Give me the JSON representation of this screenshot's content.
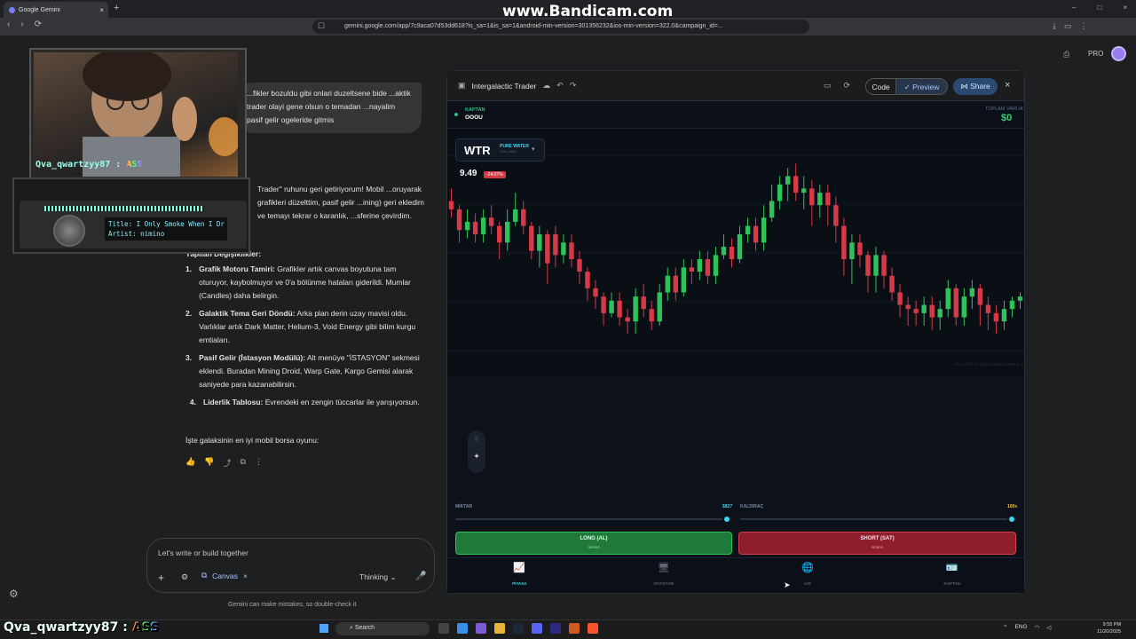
{
  "browser": {
    "tab_title": "Google Gemini",
    "tab_close": "×",
    "new_tab": "+",
    "window_controls": [
      "–",
      "□",
      "×"
    ],
    "url": "gemini.google.com/app/7c9aca07d53dd618?is_sa=1&is_sa=1&android-min-version=301356232&ios-min-version=322.0&campaign_id=...",
    "nav": [
      "‹",
      "›",
      "⟳"
    ]
  },
  "watermark": "www.Bandicam.com",
  "header": {
    "pro_label": "PRO"
  },
  "chat": {
    "user_message": "...fikler bozuldu gibi onlari duzeltsene bide ...aktik trader olayi gene olsun o temadan ...nayalim pasif gelir ogeleride gitmis",
    "response_intro": "Trader\" ruhunu geri getiriyorum! Mobil ...oruyarak grafikleri düzelttim, pasif gelir ...ining) geri ekledim ve temayı tekrar o karanlık, ...sferine çevirdim.",
    "response_heading": "Yapılan Değişiklikler:",
    "items": [
      {
        "n": "1.",
        "title": "Grafik Motoru Tamiri:",
        "text": "Grafikler artık canvas boyutuna tam oturuyor, kaybolmuyor ve 0'a bölünme hataları giderildi. Mumlar (Candles) daha belirgin."
      },
      {
        "n": "2.",
        "title": "Galaktik Tema Geri Döndü:",
        "text": "Arka plan derin uzay mavisi oldu. Varlıklar artık Dark Matter, Helium-3, Void Energy gibi bilim kurgu emtiaları."
      },
      {
        "n": "3.",
        "title": "Pasif Gelir (İstasyon Modülü):",
        "text": "Alt menüye \"İSTASYON\" sekmesi eklendi. Buradan Mining Droid, Warp Gate, Kargo Gemisi alarak saniyede para kazanabilirsin."
      },
      {
        "n": "4.",
        "title": "Liderlik Tablosu:",
        "text": "Evrendeki en zengin tüccarlar ile yarışıyorsun."
      }
    ],
    "response_outro": "İşte galaksinin en iyi mobil borsa oyunu:",
    "action_icons": [
      "👍",
      "👎",
      "⤴",
      "⧉",
      "⋮"
    ],
    "input_placeholder": "Let's write or build together",
    "plus": "+",
    "tools": "⚙",
    "canvas_chip": "Canvas",
    "canvas_close": "×",
    "thinking": "Thinking",
    "mic": "🎤",
    "disclaimer": "Gemini can make mistakes, so double-check it"
  },
  "stream": {
    "username": "Qva_qwartzyy87 :",
    "ass": "ASS",
    "radio_title": "Title: I Only Smoke When I Dr",
    "radio_artist": "Artist: nimino"
  },
  "panel": {
    "title": "Intergalactic Trader",
    "code_label": "Code",
    "preview_label": "Preview",
    "share_label": "Share",
    "close": "×"
  },
  "game": {
    "rank_label": "KAPTAN",
    "player_name": "OOOU",
    "balance_label": "TOPLAM VARLIK",
    "balance_value": "$0",
    "asset_symbol": "WTR",
    "asset_name": "PURE WATER",
    "asset_sub": "VOL HIGH",
    "price": "9.49",
    "change": "-24.07%",
    "feed_label": "GALACTIC EXCHANGE FEED v2.4",
    "amount_label": "MİKTAR",
    "amount_value": "$827",
    "leverage_label": "KALDIRAÇ",
    "leverage_value": "100x",
    "long_label": "LONG (AL)",
    "long_sub": "nimino",
    "short_label": "SHORT (SAT)",
    "short_sub": "nimino",
    "nav": [
      {
        "label": "PİYASA",
        "icon": "📈"
      },
      {
        "label": "İSTASYON",
        "icon": "🖥"
      },
      {
        "label": "LİG",
        "icon": "🌐"
      },
      {
        "label": "KAPTAN",
        "icon": "🪪"
      }
    ]
  },
  "chart_data": {
    "type": "candlestick",
    "up_color": "#2ec25a",
    "down_color": "#d63a48",
    "candles": [
      [
        9.6,
        9.5,
        9.75,
        9.4
      ],
      [
        9.5,
        9.25,
        9.55,
        9.1
      ],
      [
        9.25,
        9.35,
        9.5,
        9.15
      ],
      [
        9.35,
        9.2,
        9.45,
        9.1
      ],
      [
        9.2,
        9.4,
        9.5,
        9.1
      ],
      [
        9.4,
        9.3,
        9.55,
        9.2
      ],
      [
        9.3,
        9.1,
        9.35,
        8.9
      ],
      [
        9.1,
        9.35,
        9.5,
        9.0
      ],
      [
        9.35,
        9.5,
        9.7,
        9.3
      ],
      [
        9.5,
        9.3,
        9.6,
        9.2
      ],
      [
        9.3,
        9.0,
        9.35,
        8.9
      ],
      [
        9.0,
        9.2,
        9.3,
        8.8
      ],
      [
        9.2,
        8.85,
        9.25,
        8.6
      ],
      [
        9.2,
        8.95,
        9.3,
        8.8
      ],
      [
        8.95,
        9.1,
        9.2,
        8.85
      ],
      [
        9.1,
        8.9,
        9.2,
        8.8
      ],
      [
        8.9,
        8.75,
        9.0,
        8.6
      ],
      [
        8.75,
        8.55,
        8.8,
        8.4
      ],
      [
        8.55,
        8.45,
        8.65,
        8.3
      ],
      [
        8.45,
        8.25,
        8.5,
        8.1
      ],
      [
        8.25,
        8.4,
        8.5,
        8.2
      ],
      [
        8.4,
        8.2,
        8.5,
        8.1
      ],
      [
        8.2,
        8.15,
        8.3,
        8.0
      ],
      [
        8.15,
        8.45,
        8.55,
        8.0
      ],
      [
        8.45,
        8.3,
        8.6,
        8.2
      ],
      [
        8.3,
        8.15,
        8.4,
        8.05
      ],
      [
        8.15,
        8.5,
        8.6,
        8.1
      ],
      [
        8.5,
        8.7,
        8.8,
        8.4
      ],
      [
        8.7,
        8.5,
        8.8,
        8.4
      ],
      [
        8.5,
        8.8,
        8.9,
        8.45
      ],
      [
        8.8,
        8.75,
        8.9,
        8.6
      ],
      [
        8.75,
        8.9,
        9.0,
        8.65
      ],
      [
        8.9,
        8.7,
        9.0,
        8.6
      ],
      [
        8.7,
        8.95,
        9.05,
        8.6
      ],
      [
        8.95,
        9.05,
        9.2,
        8.9
      ],
      [
        9.05,
        8.9,
        9.15,
        8.8
      ],
      [
        8.9,
        9.2,
        9.3,
        8.85
      ],
      [
        9.2,
        9.3,
        9.4,
        9.1
      ],
      [
        9.3,
        9.1,
        9.4,
        9.0
      ],
      [
        9.1,
        9.4,
        9.55,
        9.0
      ],
      [
        9.4,
        9.6,
        9.8,
        9.35
      ],
      [
        9.6,
        9.8,
        9.9,
        9.5
      ],
      [
        9.8,
        9.9,
        10.0,
        9.6
      ],
      [
        9.9,
        9.7,
        10.05,
        9.6
      ],
      [
        9.7,
        9.75,
        9.9,
        9.5
      ],
      [
        9.75,
        9.55,
        9.85,
        9.3
      ],
      [
        9.55,
        9.7,
        9.8,
        9.4
      ],
      [
        9.7,
        9.55,
        9.8,
        9.3
      ],
      [
        9.55,
        9.3,
        9.65,
        9.1
      ],
      [
        9.3,
        8.9,
        9.4,
        8.7
      ],
      [
        8.9,
        9.1,
        9.2,
        8.6
      ],
      [
        9.1,
        8.95,
        9.2,
        8.8
      ],
      [
        8.95,
        8.7,
        9.0,
        8.5
      ],
      [
        8.7,
        8.95,
        9.05,
        8.5
      ],
      [
        8.95,
        8.7,
        9.0,
        8.55
      ],
      [
        8.7,
        8.5,
        8.8,
        8.4
      ],
      [
        8.5,
        8.35,
        8.6,
        8.2
      ],
      [
        8.35,
        8.3,
        8.45,
        8.1
      ],
      [
        8.3,
        8.25,
        8.4,
        8.1
      ],
      [
        8.25,
        8.35,
        8.45,
        8.1
      ],
      [
        8.35,
        8.2,
        8.45,
        8.05
      ],
      [
        8.2,
        8.3,
        8.4,
        8.05
      ],
      [
        8.3,
        8.55,
        8.65,
        8.2
      ],
      [
        8.55,
        8.2,
        8.6,
        8.1
      ],
      [
        8.2,
        8.45,
        8.55,
        8.1
      ],
      [
        8.45,
        8.55,
        8.65,
        8.3
      ],
      [
        8.55,
        8.35,
        8.6,
        8.1
      ],
      [
        8.35,
        8.25,
        8.45,
        8.05
      ],
      [
        8.25,
        8.15,
        8.35,
        8.0
      ],
      [
        8.15,
        8.3,
        8.4,
        8.05
      ],
      [
        8.3,
        8.4,
        8.45,
        8.2
      ],
      [
        8.4,
        8.45,
        8.5,
        8.3
      ]
    ],
    "ylim": [
      7.8,
      10.15
    ]
  }
}
